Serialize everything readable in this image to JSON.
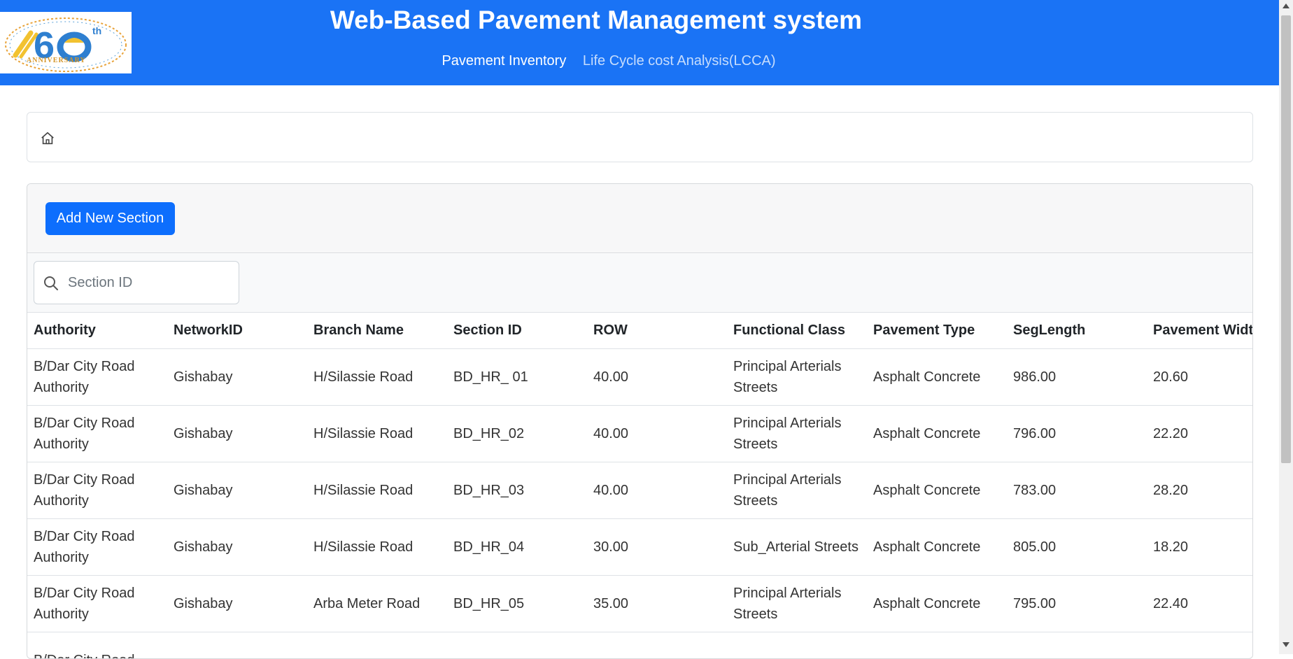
{
  "header": {
    "title": "Web-Based Pavement Management system",
    "logo_name": "60th-anniversary-logo",
    "logo_text_th": "th",
    "logo_text_anniversary": "ANNIVERSARY",
    "nav": [
      {
        "label": "Pavement Inventory"
      },
      {
        "label": "Life Cycle cost Analysis(LCCA)"
      }
    ]
  },
  "breadcrumb": {
    "icon": "home-icon"
  },
  "toolbar": {
    "add_label": "Add New Section"
  },
  "search": {
    "placeholder": "Section ID",
    "value": ""
  },
  "table": {
    "columns": [
      "Authority",
      "NetworkID",
      "Branch Name",
      "Section ID",
      "ROW",
      "Functional Class",
      "Pavement Type",
      "SegLength",
      "Pavement Width"
    ],
    "rows": [
      [
        "B/Dar City Road Authority",
        "Gishabay",
        "H/Silassie Road",
        "BD_HR_ 01",
        "40.00",
        "Principal Arterials Streets",
        "Asphalt Concrete",
        "986.00",
        "20.60"
      ],
      [
        "B/Dar City Road Authority",
        "Gishabay",
        "H/Silassie Road",
        "BD_HR_02",
        "40.00",
        "Principal Arterials Streets",
        "Asphalt Concrete",
        "796.00",
        "22.20"
      ],
      [
        "B/Dar City Road Authority",
        "Gishabay",
        "H/Silassie Road",
        "BD_HR_03",
        "40.00",
        "Principal Arterials Streets",
        "Asphalt Concrete",
        "783.00",
        "28.20"
      ],
      [
        "B/Dar City Road Authority",
        "Gishabay",
        "H/Silassie Road",
        "BD_HR_04",
        "30.00",
        "Sub_Arterial Streets",
        "Asphalt Concrete",
        "805.00",
        "18.20"
      ],
      [
        "B/Dar City Road Authority",
        "Gishabay",
        "Arba Meter Road",
        "BD_HR_05",
        "35.00",
        "Principal Arterials Streets",
        "Asphalt Concrete",
        "795.00",
        "22.40"
      ],
      [
        "B/Dar City Road",
        "",
        "",
        "",
        "",
        "",
        "",
        "",
        ""
      ]
    ]
  },
  "colors": {
    "header_bg": "#1a73f5",
    "button_bg": "#0d6efd"
  }
}
